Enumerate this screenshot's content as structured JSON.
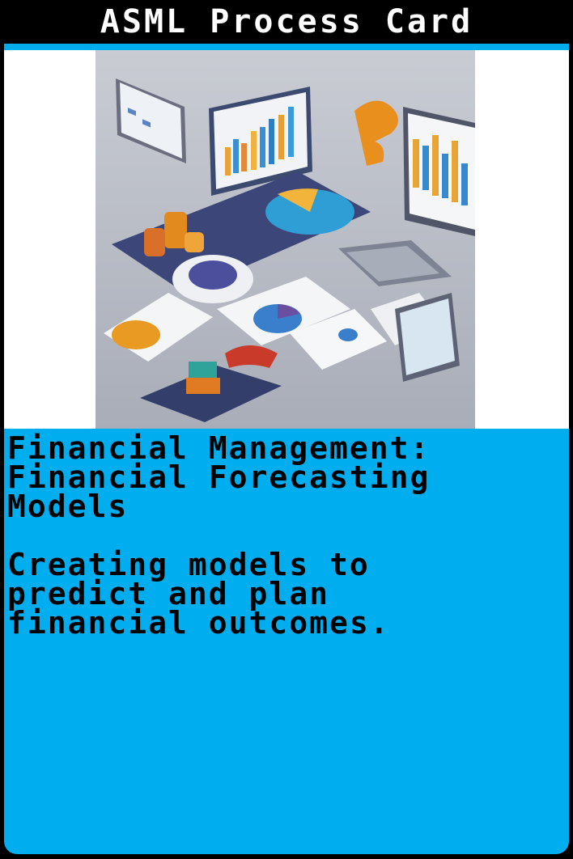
{
  "card": {
    "header": "ASML Process Card",
    "title": "Financial Management:\nFinancial Forecasting\nModels",
    "description": "Creating models to\npredict and plan\nfinancial outcomes."
  },
  "illustration": {
    "icon": "financial-dashboard-illustration"
  },
  "colors": {
    "frame": "#000000",
    "accent": "#00aeef",
    "image_bg": "#ffffff",
    "text_header": "#ffffff",
    "text_body": "#000000"
  }
}
